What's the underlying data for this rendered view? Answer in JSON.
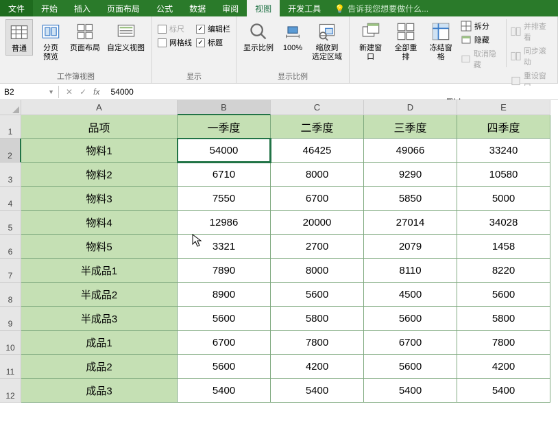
{
  "menu": {
    "file": "文件",
    "home": "开始",
    "insert": "插入",
    "pageLayout": "页面布局",
    "formulas": "公式",
    "data": "数据",
    "review": "审阅",
    "view": "视图",
    "developer": "开发工具",
    "tellMe": "告诉我您想要做什么..."
  },
  "ribbon": {
    "workbookViews": {
      "label": "工作簿视图",
      "normal": "普通",
      "pageBreak": "分页\n预览",
      "pageLayoutBtn": "页面布局",
      "customViews": "自定义视图"
    },
    "show": {
      "label": "显示",
      "ruler": "标尺",
      "formulaBar": "编辑栏",
      "gridlines": "网格线",
      "headings": "标题"
    },
    "zoom": {
      "label": "显示比例",
      "zoom": "显示比例",
      "hundred": "100%",
      "toSelection": "缩放到\n选定区域"
    },
    "window": {
      "label": "窗口",
      "newWindow": "新建窗口",
      "arrangeAll": "全部重排",
      "freezePanes": "冻结窗格",
      "split": "拆分",
      "hide": "隐藏",
      "unhide": "取消隐藏",
      "sideBySide": "并排查看",
      "syncScroll": "同步滚动",
      "resetPos": "重设窗口"
    }
  },
  "nameBox": "B2",
  "formulaValue": "54000",
  "columns": [
    "A",
    "B",
    "C",
    "D",
    "E"
  ],
  "headerRow": [
    "品项",
    "一季度",
    "二季度",
    "三季度",
    "四季度"
  ],
  "rows": [
    {
      "n": "2",
      "cells": [
        "物料1",
        "54000",
        "46425",
        "49066",
        "33240"
      ]
    },
    {
      "n": "3",
      "cells": [
        "物料2",
        "6710",
        "8000",
        "9290",
        "10580"
      ]
    },
    {
      "n": "4",
      "cells": [
        "物料3",
        "7550",
        "6700",
        "5850",
        "5000"
      ]
    },
    {
      "n": "5",
      "cells": [
        "物料4",
        "12986",
        "20000",
        "27014",
        "34028"
      ]
    },
    {
      "n": "6",
      "cells": [
        "物料5",
        "3321",
        "2700",
        "2079",
        "1458"
      ]
    },
    {
      "n": "7",
      "cells": [
        "半成品1",
        "7890",
        "8000",
        "8110",
        "8220"
      ]
    },
    {
      "n": "8",
      "cells": [
        "半成品2",
        "8900",
        "5600",
        "4500",
        "5600"
      ]
    },
    {
      "n": "9",
      "cells": [
        "半成品3",
        "5600",
        "5800",
        "5600",
        "5800"
      ]
    },
    {
      "n": "10",
      "cells": [
        "成品1",
        "6700",
        "7800",
        "6700",
        "7800"
      ]
    },
    {
      "n": "11",
      "cells": [
        "成品2",
        "5600",
        "4200",
        "5600",
        "4200"
      ]
    },
    {
      "n": "12",
      "cells": [
        "成品3",
        "5400",
        "5400",
        "5400",
        "5400"
      ]
    }
  ],
  "activeCell": {
    "row": 0,
    "col": 1
  }
}
